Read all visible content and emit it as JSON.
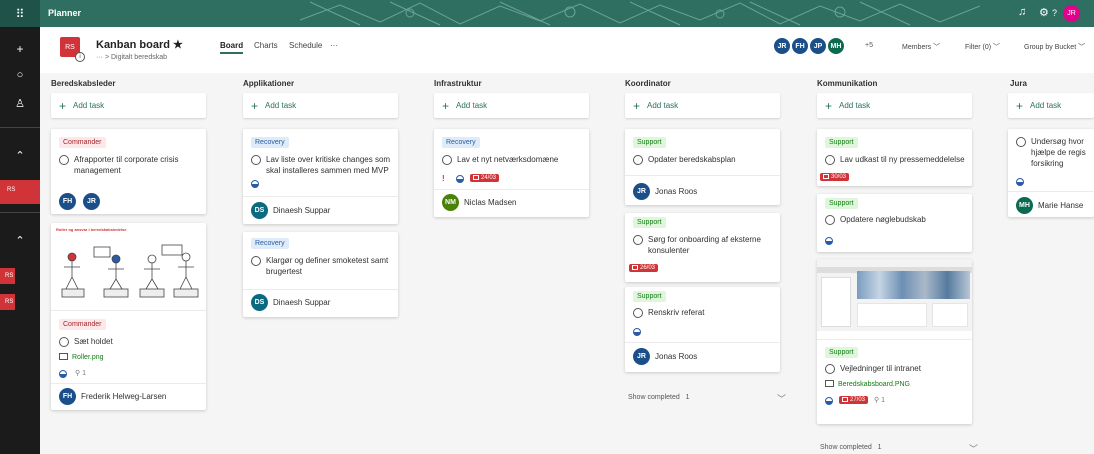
{
  "app": {
    "name": "Planner",
    "user_initials": "JR"
  },
  "plan": {
    "logo": "RS",
    "title": "Kanban board",
    "star": "★",
    "breadcrumb": "··· > Digitalt beredskab",
    "info": "i"
  },
  "tabs": [
    {
      "label": "Board"
    },
    {
      "label": "Charts"
    },
    {
      "label": "Schedule"
    },
    {
      "label": "···"
    }
  ],
  "members": {
    "avatars": [
      {
        "initials": "JR"
      },
      {
        "initials": "FH"
      },
      {
        "initials": "JP"
      },
      {
        "initials": "MH"
      }
    ],
    "more": "+5",
    "label": "Members",
    "filter": "Filter (0)",
    "group": "Group by Bucket"
  },
  "rail": {
    "rs1": "RS",
    "rs2": "RS",
    "rs3": "RS"
  },
  "add_task": "Add task",
  "columns": [
    {
      "title": "Beredskabsleder"
    },
    {
      "title": "Applikationer"
    },
    {
      "title": "Infrastruktur"
    },
    {
      "title": "Koordinator"
    },
    {
      "title": "Kommunikation"
    },
    {
      "title": "Jura"
    }
  ],
  "cards": {
    "c0a": {
      "label": "Commander",
      "title": "Afrapporter til corporate crisis management",
      "a1": "FH",
      "a2": "JR"
    },
    "c0b": {
      "label": "Commander",
      "title": "Sæt holdet",
      "attachment": "Roller.png",
      "attach_count": "1",
      "assignee_initials": "FH",
      "assignee": "Frederik Helweg-Larsen",
      "img_title": "Roller og ansvar i beredskabsledelse"
    },
    "c1a": {
      "label": "Recovery",
      "title": "Lav liste over kritiske changes som skal installeres sammen med MVP",
      "assignee_initials": "DS",
      "assignee": "Dinaesh Suppar"
    },
    "c1b": {
      "label": "Recovery",
      "title": "Klargør og definer smoketest samt brugertest",
      "assignee_initials": "DS",
      "assignee": "Dinaesh Suppar"
    },
    "c2a": {
      "label": "Recovery",
      "title": "Lav et nyt netværksdomæne",
      "urgent": "!",
      "date": "24/03",
      "assignee_initials": "NM",
      "assignee": "Niclas Madsen"
    },
    "c3a": {
      "label": "Support",
      "title": "Opdater beredskabsplan",
      "assignee_initials": "JR",
      "assignee": "Jonas Roos"
    },
    "c3b": {
      "label": "Support",
      "title": "Sørg for onboarding af eksterne konsulenter",
      "date": "26/03"
    },
    "c3c": {
      "label": "Support",
      "title": "Renskriv referat",
      "assignee_initials": "JR",
      "assignee": "Jonas Roos"
    },
    "c4a": {
      "label": "Support",
      "title": "Lav udkast til ny pressemeddelelse",
      "date": "30/03"
    },
    "c4b": {
      "label": "Support",
      "title": "Opdatere nøglebudskab"
    },
    "c4c": {
      "label": "Support",
      "title": "Vejledninger til intranet",
      "attachment": "Beredskabsboard.PNG",
      "date": "27/03",
      "attach_count": "1"
    },
    "c5a": {
      "title": "Undersøg hvor hjælpe de regis forsikring",
      "assignee_initials": "MH",
      "assignee": "Marie Hanse"
    }
  },
  "show_completed": {
    "c3": "Show completed   1",
    "c4": "Show completed   1"
  },
  "colors": {
    "topbar": "#2e6f62",
    "accent": "#2e6f62",
    "red": "#d13438",
    "blue_avatar": "#1b4f8a"
  }
}
